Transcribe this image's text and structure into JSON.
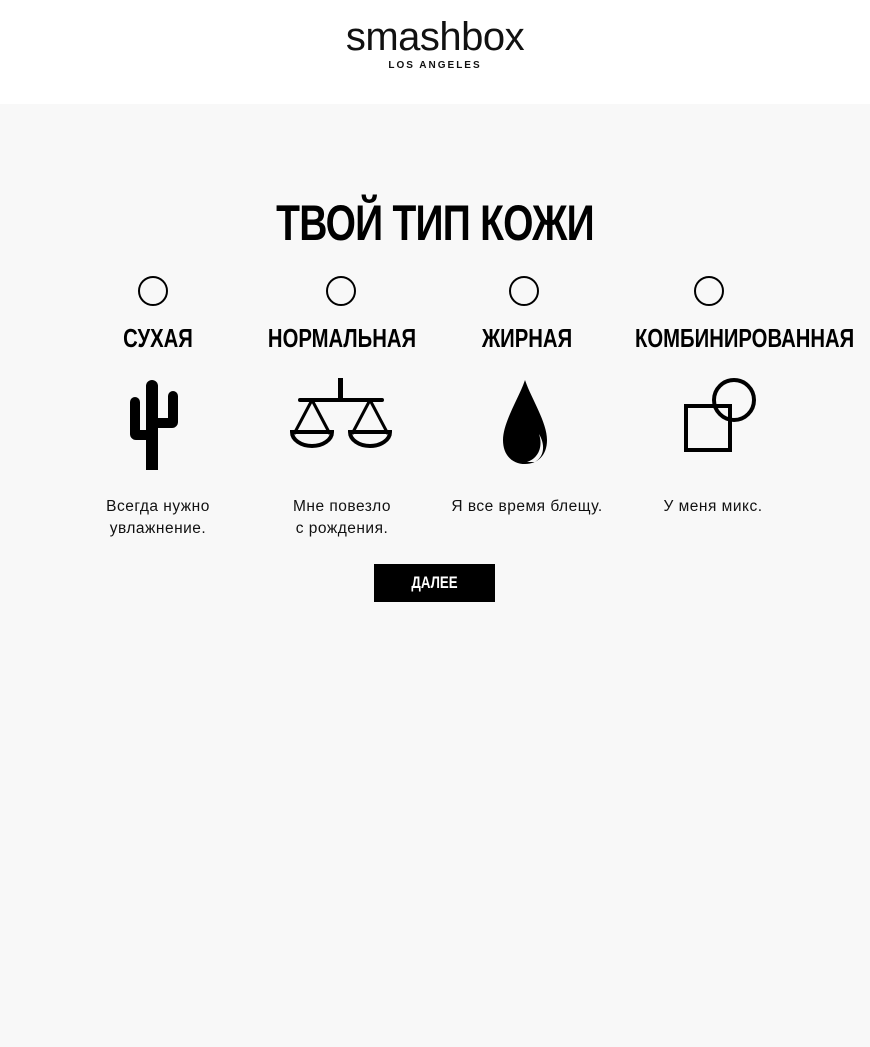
{
  "header": {
    "logo_word": "smashbox",
    "logo_sub": "LOS ANGELES"
  },
  "page": {
    "title": "ТВОЙ ТИП КОЖИ"
  },
  "options": [
    {
      "label": "СУХАЯ",
      "description": "Всегда нужно увлажнение.",
      "icon": "cactus-icon",
      "selected": false
    },
    {
      "label": "НОРМАЛЬНАЯ",
      "description": "Мне повезло с рождения.",
      "icon": "scales-icon",
      "selected": false
    },
    {
      "label": "ЖИРНАЯ",
      "description": "Я все время блещу.",
      "icon": "drop-icon",
      "selected": false
    },
    {
      "label": "КОМБИНИРОВАННАЯ",
      "description": "У меня микс.",
      "icon": "square-circle-icon",
      "selected": false
    }
  ],
  "actions": {
    "next_label": "ДАЛЕЕ"
  },
  "colors": {
    "background": "#f8f8f8",
    "header": "#ffffff",
    "accent": "#000000"
  }
}
